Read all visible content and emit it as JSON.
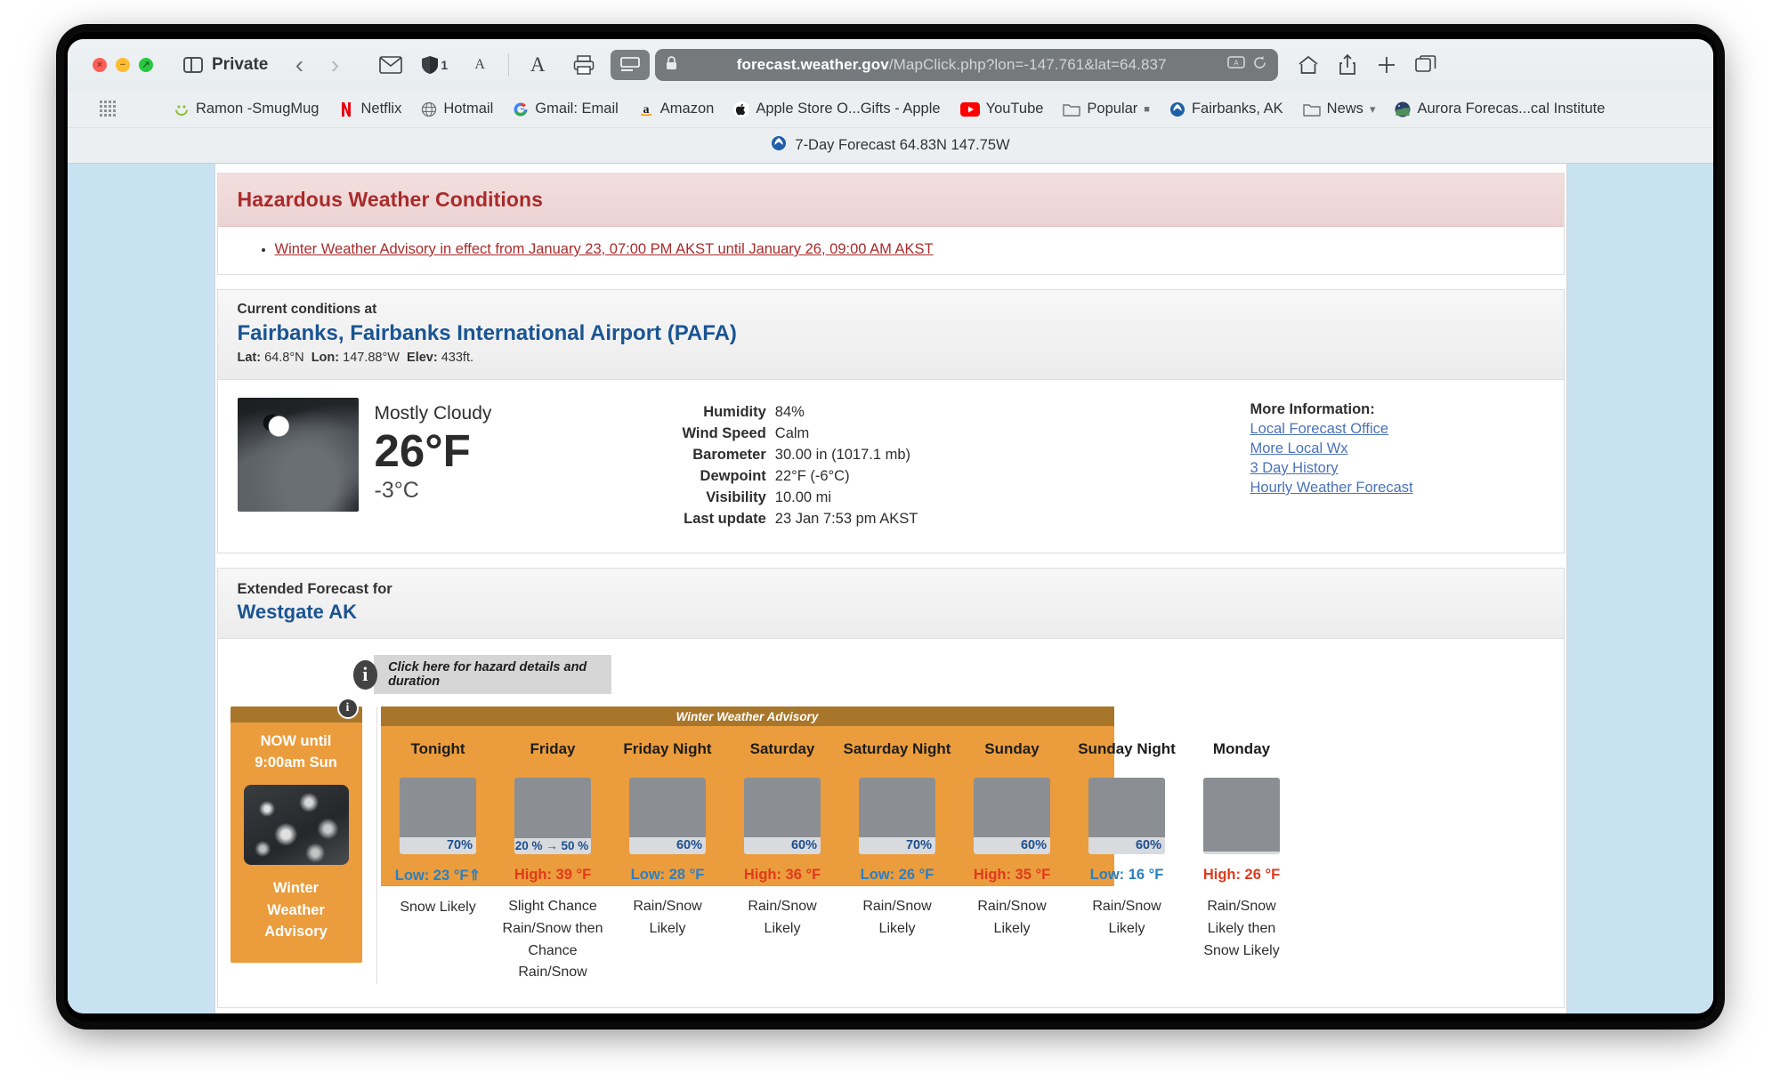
{
  "browser": {
    "private_label": "Private",
    "shield_count": "1",
    "url": {
      "host": "forecast.weather.gov",
      "path": "/MapClick.php?lon=-147.761&lat=64.837"
    },
    "bookmarks": [
      {
        "label": "Ramon -SmugMug",
        "icon": "smugmug-icon"
      },
      {
        "label": "Netflix",
        "icon": "netflix-icon"
      },
      {
        "label": "Hotmail",
        "icon": "globe-icon"
      },
      {
        "label": "Gmail: Email",
        "icon": "gmail-icon"
      },
      {
        "label": "Amazon",
        "icon": "amazon-icon"
      },
      {
        "label": "Apple Store O...Gifts - Apple",
        "icon": "apple-icon"
      },
      {
        "label": "YouTube",
        "icon": "youtube-icon"
      },
      {
        "label": "Popular",
        "icon": "folder-icon"
      },
      {
        "label": "Fairbanks, AK",
        "icon": "noaa-icon"
      },
      {
        "label": "News",
        "icon": "folder-icon"
      },
      {
        "label": "Aurora Forecas...cal Institute",
        "icon": "aurora-icon"
      }
    ],
    "tab_title": "7-Day Forecast 64.83N 147.75W"
  },
  "hazard": {
    "heading": "Hazardous Weather Conditions",
    "items": [
      "Winter Weather Advisory in effect from January 23, 07:00 PM AKST until January 26, 09:00 AM AKST"
    ]
  },
  "current": {
    "sub": "Current conditions at",
    "station": "Fairbanks, Fairbanks International Airport (PAFA)",
    "lat_label": "Lat:",
    "lat_value": "64.8°N",
    "lon_label": "Lon:",
    "lon_value": "147.88°W",
    "elev_label": "Elev:",
    "elev_value": "433ft.",
    "condition": "Mostly Cloudy",
    "temp_f": "26°F",
    "temp_c": "-3°C",
    "details": [
      {
        "key": "Humidity",
        "value": "84%"
      },
      {
        "key": "Wind Speed",
        "value": "Calm"
      },
      {
        "key": "Barometer",
        "value": "30.00 in (1017.1 mb)"
      },
      {
        "key": "Dewpoint",
        "value": "22°F (-6°C)"
      },
      {
        "key": "Visibility",
        "value": "10.00 mi"
      },
      {
        "key": "Last update",
        "value": "23 Jan 7:53 pm AKST"
      }
    ],
    "more_info_title": "More Information:",
    "more_info_links": [
      "Local Forecast Office",
      "More Local Wx",
      "3 Day History",
      "Hourly Weather Forecast"
    ]
  },
  "extended": {
    "sub": "Extended Forecast for",
    "location": "Westgate AK",
    "hazard_click_label": "Click here for hazard details and duration",
    "advisory_banner": "Winter Weather Advisory",
    "now_card": {
      "title_line1": "NOW until",
      "title_line2": "9:00am Sun",
      "text_line1": "Winter",
      "text_line2": "Weather",
      "text_line3": "Advisory"
    },
    "days": [
      {
        "name": "Tonight",
        "pop": "70%",
        "temp_label": "Low: 23 °F⇑",
        "temp_type": "low",
        "desc": "Snow Likely",
        "icon": "snow-night-icon",
        "advisory": true
      },
      {
        "name": "Friday",
        "pop": "20 % → 50 %",
        "temp_label": "High: 39 °F",
        "temp_type": "high",
        "desc": "Slight Chance Rain/Snow then Chance Rain/Snow",
        "icon": "rain-snow-day-icon",
        "advisory": true
      },
      {
        "name": "Friday Night",
        "pop": "60%",
        "temp_label": "Low: 28 °F",
        "temp_type": "low",
        "desc": "Rain/Snow Likely",
        "icon": "rain-snow-night-icon",
        "advisory": true
      },
      {
        "name": "Saturday",
        "pop": "60%",
        "temp_label": "High: 36 °F",
        "temp_type": "high",
        "desc": "Rain/Snow Likely",
        "icon": "rain-snow-day-icon",
        "advisory": true
      },
      {
        "name": "Saturday Night",
        "pop": "70%",
        "temp_label": "Low: 26 °F",
        "temp_type": "low",
        "desc": "Rain/Snow Likely",
        "icon": "rain-snow-night-icon",
        "advisory": true
      },
      {
        "name": "Sunday",
        "pop": "60%",
        "temp_label": "High: 35 °F",
        "temp_type": "high",
        "desc": "Rain/Snow Likely",
        "icon": "rain-snow-day-icon",
        "advisory": false
      },
      {
        "name": "Sunday Night",
        "pop": "60%",
        "temp_label": "Low: 16 °F",
        "temp_type": "low",
        "desc": "Rain/Snow Likely",
        "icon": "rain-snow-night-icon",
        "advisory": false
      },
      {
        "name": "Monday",
        "pop": "",
        "temp_label": "High: 26 °F",
        "temp_type": "high",
        "desc": "Rain/Snow Likely then Snow Likely",
        "icon": "snow-day-icon",
        "advisory": false
      }
    ]
  },
  "colors": {
    "advisory_orange": "#eb9c3c",
    "advisory_brown": "#a8762b",
    "hazard_red": "#a92b2b",
    "link_blue": "#4a72b8",
    "heading_blue": "#1a5493",
    "low_blue": "#2b7fc4",
    "high_red": "#e03a1d"
  }
}
